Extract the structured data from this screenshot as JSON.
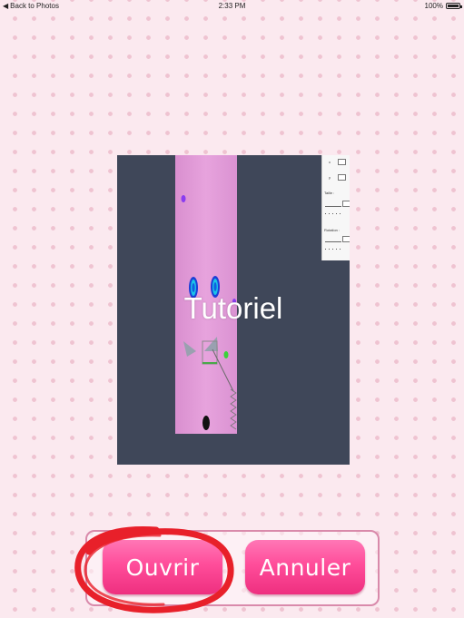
{
  "status_bar": {
    "back_label": "Back to Photos",
    "time": "2:33 PM",
    "battery": "100%"
  },
  "preview": {
    "title": "Tutoriel",
    "tool_panel": {
      "label_1": "Taille :",
      "label_2": "Rotation :"
    }
  },
  "dialog": {
    "open_label": "Ouvrir",
    "cancel_label": "Annuler"
  },
  "colors": {
    "background": "#fbe9ef",
    "dots": "#efc3d1",
    "button_pink": "#ff4d9a",
    "highlight_red": "#e8202a",
    "preview_dark": "#3f4759"
  }
}
